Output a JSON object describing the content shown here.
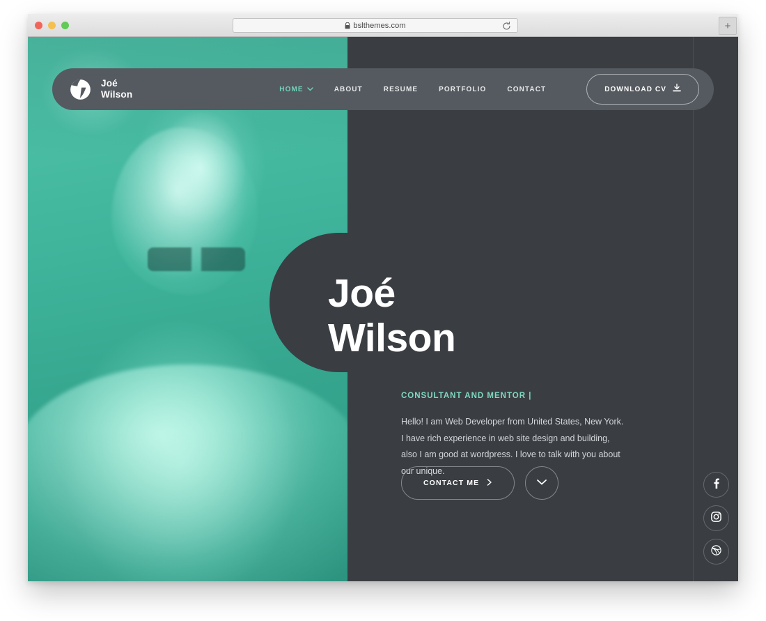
{
  "browser": {
    "url": "bslthemes.com",
    "lock_icon": "lock-icon",
    "reload_icon": "reload-icon",
    "new_tab_label": "+",
    "window_buttons": [
      {
        "name": "close",
        "color": "#f1655b"
      },
      {
        "name": "minimize",
        "color": "#f5c04e"
      },
      {
        "name": "maximize",
        "color": "#63ca57"
      }
    ]
  },
  "theme": {
    "dark_bg": "#3a3e43",
    "nav_bg": "#555a60",
    "accent_teal": "#72d3bd",
    "photo_teal": "#3fb89f",
    "text_light": "#d3d6d9",
    "white": "#ffffff"
  },
  "header": {
    "logo_icon": "brand-logo-icon",
    "brand_name": "Joé\nWilson",
    "nav": [
      {
        "label": "HOME",
        "active": true,
        "chevron": true
      },
      {
        "label": "ABOUT",
        "active": false,
        "chevron": false
      },
      {
        "label": "RESUME",
        "active": false,
        "chevron": false
      },
      {
        "label": "PORTFOLIO",
        "active": false,
        "chevron": false
      },
      {
        "label": "CONTACT",
        "active": false,
        "chevron": false
      }
    ],
    "cta": {
      "label": "DOWNLOAD CV",
      "icon": "download-icon"
    }
  },
  "hero": {
    "name": "Joé\nWilson",
    "role": "CONSULTANT AND MENTOR |",
    "description": "Hello! I am Web Developer from United States, New York. I have rich experience in web site design and building, also I am good at wordpress. I love to talk with you about our unique.",
    "primary_button": {
      "label": "CONTACT ME",
      "icon": "arrow-right-icon"
    },
    "scroll_button": {
      "icon": "chevron-down-icon"
    },
    "photo_alt": "portrait-photo-teal-duotone"
  },
  "social": [
    {
      "name": "facebook",
      "icon": "facebook-icon"
    },
    {
      "name": "instagram",
      "icon": "instagram-icon"
    },
    {
      "name": "dribbble",
      "icon": "dribbble-icon"
    }
  ]
}
